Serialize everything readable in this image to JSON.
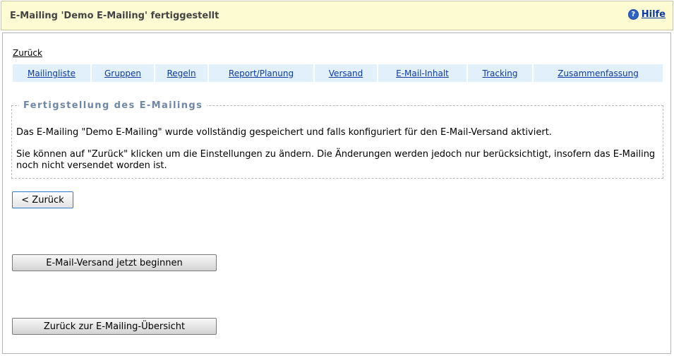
{
  "header": {
    "title": "E-Mailing 'Demo E-Mailing' fertiggestellt",
    "help_label": "Hilfe",
    "help_icon": "question-icon",
    "background": "#fdfbd2"
  },
  "nav": {
    "back_link": "Zurück",
    "tabs": [
      {
        "label": "Mailingliste"
      },
      {
        "label": "Gruppen"
      },
      {
        "label": "Regeln"
      },
      {
        "label": "Report/Planung"
      },
      {
        "label": "Versand"
      },
      {
        "label": "E-Mail-Inhalt"
      },
      {
        "label": "Tracking"
      },
      {
        "label": "Zusammenfassung"
      }
    ],
    "tab_background": "#e1f0fb",
    "link_color": "#0b3aa8"
  },
  "section": {
    "legend": "Fertigstellung des E-Mailings",
    "paragraph1": "Das E-Mailing \"Demo E-Mailing\" wurde vollständig gespeichert und falls konfiguriert für den E-Mail-Versand aktiviert.",
    "paragraph2": "Sie können auf \"Zurück\" klicken um die Einstellungen zu ändern. Die Änderungen werden jedoch nur berücksichtigt, insofern das E-Mailing noch nicht versendet worden ist."
  },
  "buttons": {
    "back": "< Zurück",
    "start_sending": "E-Mail-Versand jetzt beginnen",
    "back_to_overview": "Zurück zur E-Mailing-Übersicht"
  }
}
